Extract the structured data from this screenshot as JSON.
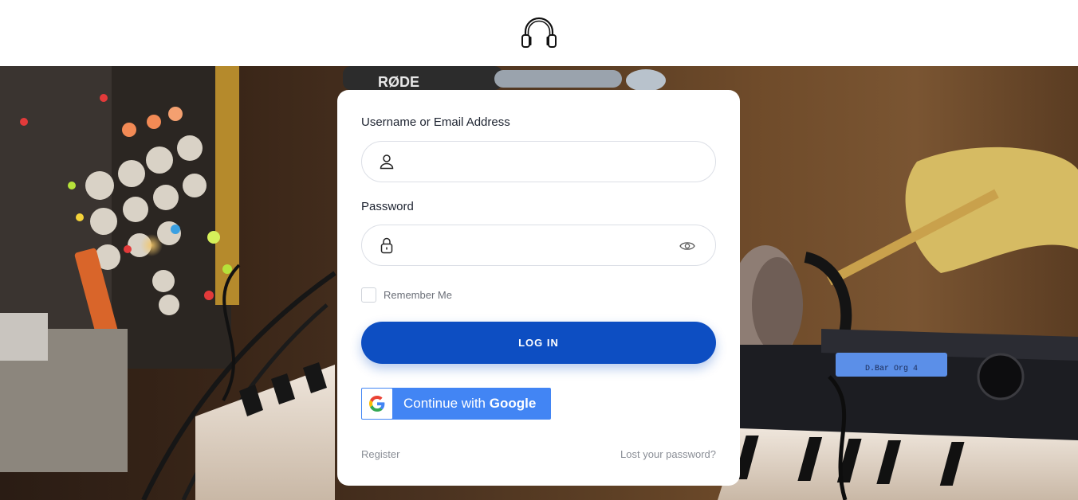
{
  "header": {
    "logo_icon": "headphones-icon"
  },
  "hero": {
    "brand_text": "RØDE",
    "display_text": "D.Bar Org 4"
  },
  "form": {
    "username_label": "Username or Email Address",
    "username_value": "",
    "password_label": "Password",
    "password_value": "",
    "remember_label": "Remember Me",
    "remember_checked": false,
    "login_label": "LOG IN",
    "google_prefix": "Continue with ",
    "google_brand": "Google",
    "register_label": "Register",
    "lost_password_label": "Lost your password?"
  },
  "colors": {
    "primary": "#0d4ec2",
    "google_blue": "#4285f4",
    "text_dark": "#1d2330",
    "text_muted": "#8a8e96"
  }
}
